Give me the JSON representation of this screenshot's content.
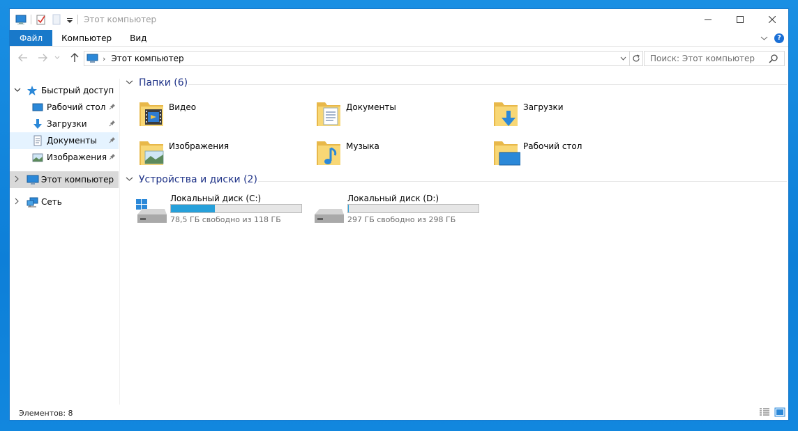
{
  "window": {
    "title": "Этот компьютер"
  },
  "ribbon": {
    "tabs": [
      "Файл",
      "Компьютер",
      "Вид"
    ]
  },
  "address": {
    "path": "Этот компьютер"
  },
  "search": {
    "placeholder": "Поиск: Этот компьютер"
  },
  "sidebar": {
    "quick_access": "Быстрый доступ",
    "items": [
      {
        "label": "Рабочий стол",
        "pinned": true,
        "icon": "desktop-icon"
      },
      {
        "label": "Загрузки",
        "pinned": true,
        "icon": "download-arrow-icon"
      },
      {
        "label": "Документы",
        "pinned": true,
        "icon": "documents-icon"
      },
      {
        "label": "Изображения",
        "pinned": true,
        "icon": "pictures-icon"
      }
    ],
    "this_pc": "Этот компьютер",
    "network": "Сеть"
  },
  "folders": {
    "header": "Папки (6)",
    "items": [
      {
        "name": "Видео",
        "icon": "video-folder-icon"
      },
      {
        "name": "Документы",
        "icon": "documents-folder-icon"
      },
      {
        "name": "Загрузки",
        "icon": "downloads-folder-icon"
      },
      {
        "name": "Изображения",
        "icon": "pictures-folder-icon"
      },
      {
        "name": "Музыка",
        "icon": "music-folder-icon"
      },
      {
        "name": "Рабочий стол",
        "icon": "desktop-folder-icon"
      }
    ]
  },
  "devices": {
    "header": "Устройства и диски (2)",
    "items": [
      {
        "name": "Локальный диск (C:)",
        "free": "78,5 ГБ свободно из 118 ГБ",
        "used_fraction": 0.335,
        "icon": "windows-drive-icon"
      },
      {
        "name": "Локальный диск (D:)",
        "free": "297 ГБ свободно из 298 ГБ",
        "used_fraction": 0.003,
        "icon": "drive-icon"
      }
    ]
  },
  "status": {
    "count": "Элементов: 8"
  },
  "colors": {
    "accent": "#1979ca",
    "drive_fill": "#26a0da",
    "group_header": "#1e3287",
    "folder": "#f8d775"
  }
}
